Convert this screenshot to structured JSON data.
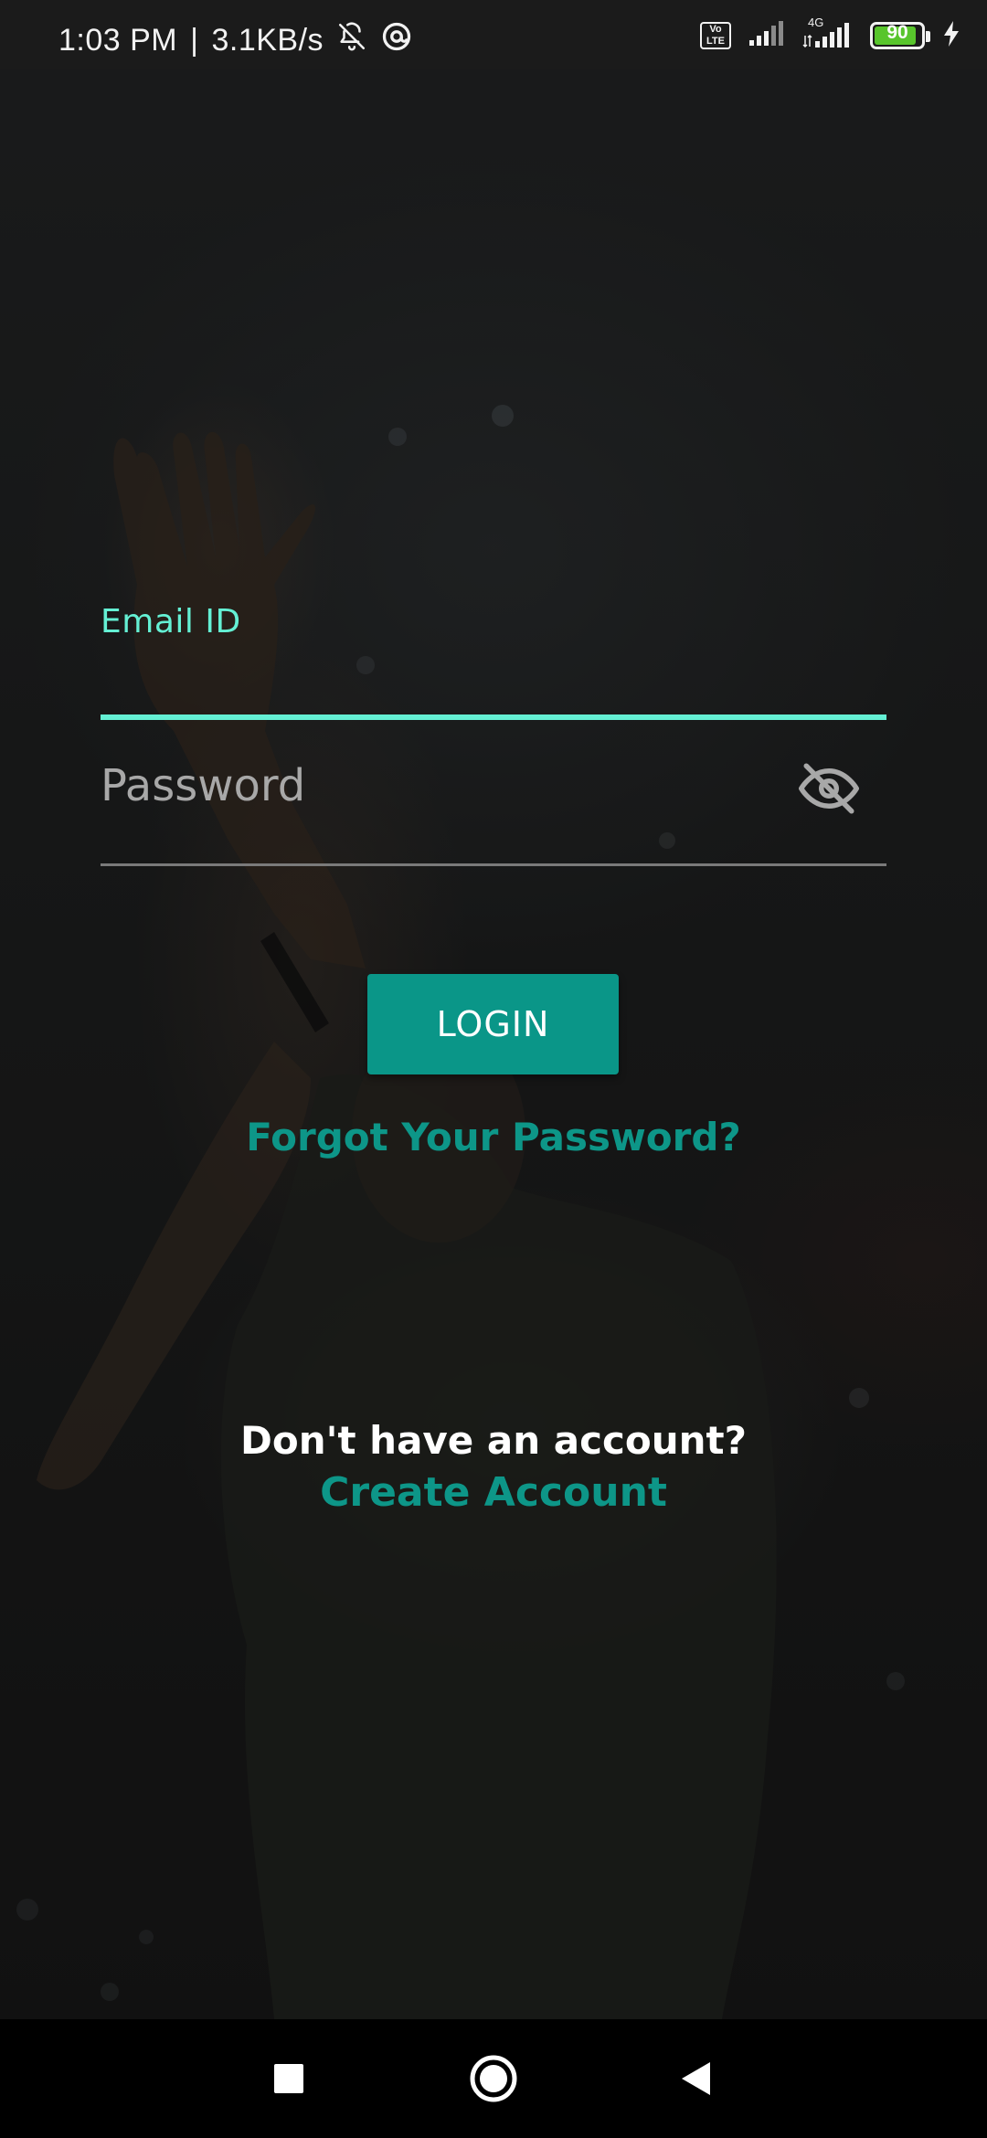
{
  "status_bar": {
    "time": "1:03 PM",
    "separator": "|",
    "network_speed": "3.1KB/s",
    "icons": [
      "bell-off-icon",
      "at-sign-icon",
      "volte-icon",
      "signal-icon",
      "4g-signal-icon",
      "battery-icon",
      "charging-icon"
    ],
    "volte_label": "Vo LTE",
    "network_type": "4G",
    "battery_level": "90",
    "battery_fraction": 0.9
  },
  "login_form": {
    "email_label": "Email ID",
    "email_value": "",
    "password_placeholder": "Password",
    "password_toggle_icon": "eye-off-icon",
    "login_button": "LOGIN",
    "forgot_password": "Forgot Your Password?",
    "no_account_text": "Don't have an account?",
    "create_account": "Create Account"
  },
  "colors": {
    "accent": "#64f0d4",
    "primary": "#0a9688",
    "link": "#0d9688"
  },
  "nav_bar": {
    "buttons": [
      "recents-square-icon",
      "home-circle-icon",
      "back-triangle-icon"
    ]
  }
}
